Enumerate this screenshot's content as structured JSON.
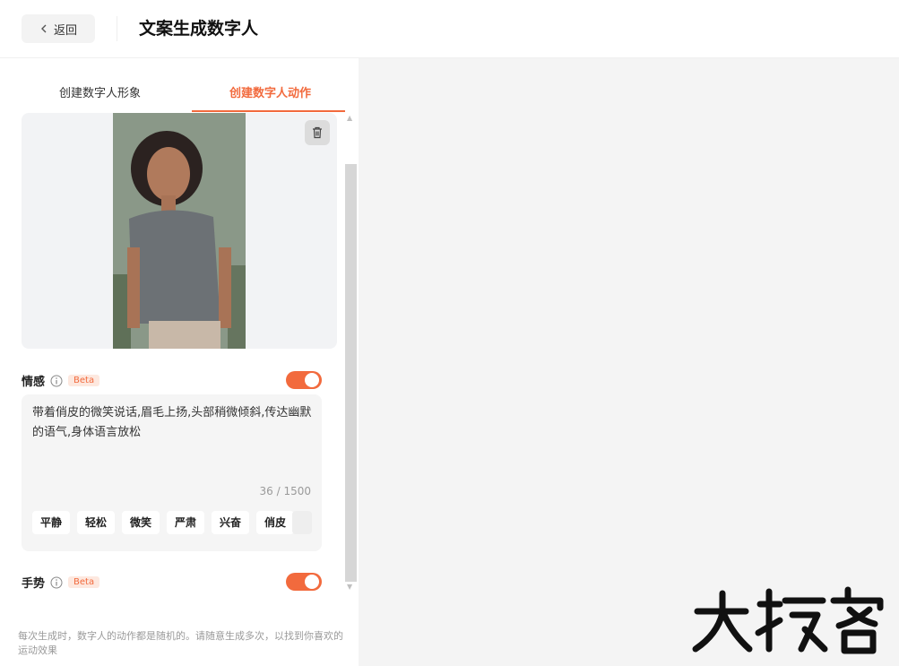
{
  "header": {
    "back_label": "返回",
    "title": "文案生成数字人"
  },
  "tabs": [
    {
      "label": "创建数字人形象",
      "active": false
    },
    {
      "label": "创建数字人动作",
      "active": true
    }
  ],
  "emotion": {
    "label": "情感",
    "badge": "Beta",
    "enabled": true,
    "text": "带着俏皮的微笑说话,眉毛上扬,头部稍微倾斜,传达幽默的语气,身体语言放松",
    "counter": "36 / 1500",
    "chips": [
      "平静",
      "轻松",
      "微笑",
      "严肃",
      "兴奋",
      "俏皮"
    ]
  },
  "gesture": {
    "label": "手势",
    "badge": "Beta",
    "enabled": true
  },
  "footnote": "每次生成时，数字人的动作都是随机的。请随意生成多次，以找到你喜欢的运动效果",
  "watermark": "大玩客",
  "colors": {
    "accent": "#f26a3d",
    "right_pane_bg": "#f4f4f4"
  }
}
